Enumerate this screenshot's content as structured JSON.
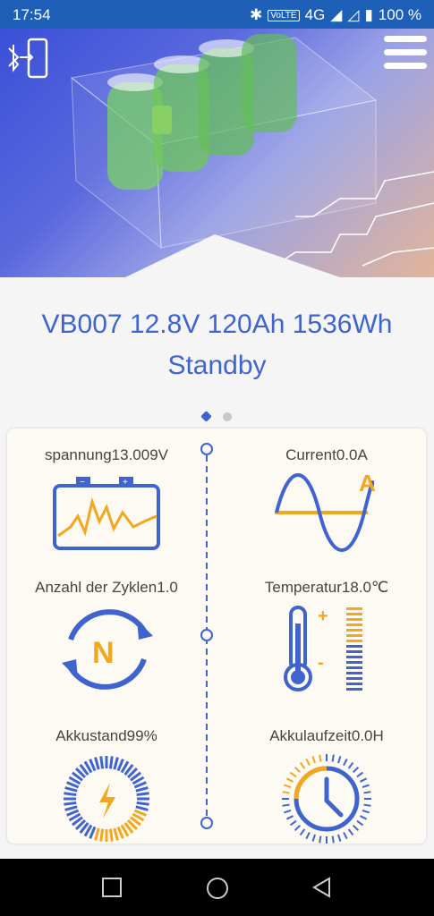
{
  "status": {
    "time": "17:54",
    "network": "VoLTE",
    "signal": "4G",
    "battery": "100 %"
  },
  "header": {
    "device_title": "VB007 12.8V 120Ah 1536Wh",
    "state": "Standby"
  },
  "pager": {
    "pages": 2,
    "active": 1
  },
  "metrics": {
    "voltage": "spannung13.009V",
    "current": "Current0.0A",
    "cycles": "Anzahl der Zyklen1.0",
    "temperature": "Temperatur18.0℃",
    "soc": "Akkustand99%",
    "runtime": "Akkulaufzeit0.0H"
  },
  "icons": {
    "current_unit": "A",
    "cycles_letter": "N",
    "temp_plus": "+",
    "temp_minus": "-"
  },
  "colors": {
    "accent_blue": "#3f64d0",
    "accent_orange": "#f2a71c",
    "status_bar": "#1e5fb8"
  }
}
